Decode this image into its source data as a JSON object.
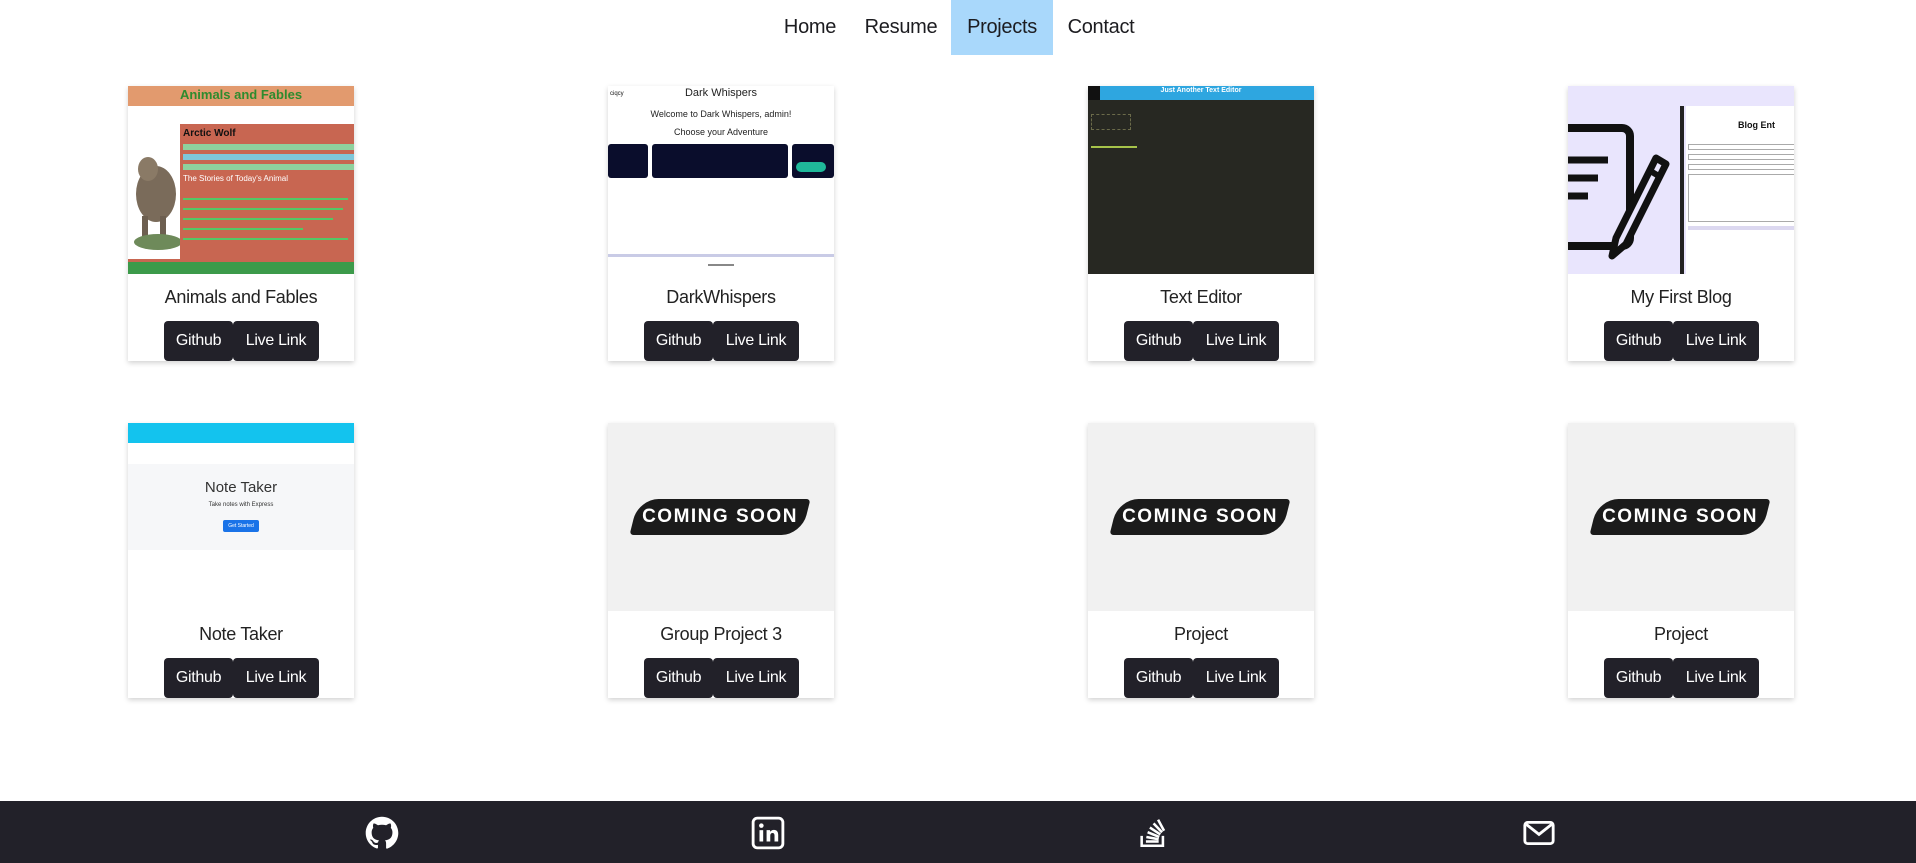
{
  "nav": {
    "items": [
      {
        "label": "Home"
      },
      {
        "label": "Resume"
      },
      {
        "label": "Projects"
      },
      {
        "label": "Contact"
      }
    ],
    "active": "Projects"
  },
  "projects": [
    {
      "title": "Animals and Fables",
      "github": "Github",
      "live": "Live Link",
      "thumb": {
        "heading": "Animals and Fables",
        "animal": "Arctic Wolf",
        "section": "The Stories of Today's Animal"
      }
    },
    {
      "title": "DarkWhispers",
      "github": "Github",
      "live": "Live Link",
      "thumb": {
        "logo": "ciqcy",
        "heading": "Dark Whispers",
        "welcome": "Welcome to Dark Whispers, admin!",
        "prompt": "Choose your Adventure"
      }
    },
    {
      "title": "Text Editor",
      "github": "Github",
      "live": "Live Link",
      "thumb": {
        "heading": "Just Another Text Editor"
      }
    },
    {
      "title": "My First Blog",
      "github": "Github",
      "live": "Live Link",
      "thumb": {
        "heading": "Blog Ent"
      }
    },
    {
      "title": "Note Taker",
      "github": "Github",
      "live": "Live Link",
      "thumb": {
        "heading": "Note Taker",
        "sub": "Take notes with Express",
        "button": "Get Started"
      }
    },
    {
      "title": "Group Project 3",
      "github": "Github",
      "live": "Live Link",
      "thumb": {
        "banner": "COMING SOON"
      }
    },
    {
      "title": "Project",
      "github": "Github",
      "live": "Live Link",
      "thumb": {
        "banner": "COMING SOON"
      }
    },
    {
      "title": "Project",
      "github": "Github",
      "live": "Live Link",
      "thumb": {
        "banner": "COMING SOON"
      }
    }
  ],
  "footer": {
    "icons": [
      "github-icon",
      "linkedin-icon",
      "stackoverflow-icon",
      "mail-icon"
    ]
  },
  "colors": {
    "nav_active": "#a9d8fb",
    "button": "#222129",
    "footer": "#222129"
  }
}
